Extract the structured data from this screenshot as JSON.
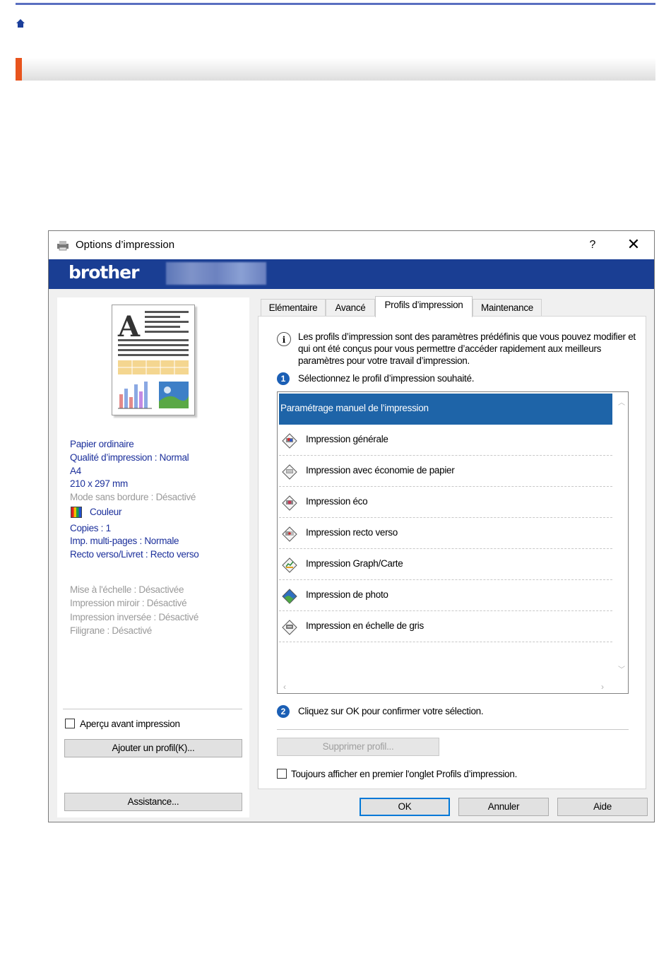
{
  "page": {
    "accent_color": "#e8541d",
    "line_color": "#5a6fc0"
  },
  "dialog": {
    "title": "Options d’impression",
    "help_label": "?",
    "close_label": "✕",
    "brand": "brother",
    "brand_color": "#1a3e93"
  },
  "summary": {
    "paper_type": "Papier ordinaire",
    "quality": "Qualité d’impression : Normal",
    "paper_size": "A4",
    "paper_dims": "210 x 297 mm",
    "borderless": "Mode sans bordure : Désactivé",
    "color_mode": "Couleur",
    "copies": "Copies : 1",
    "multipage": "Imp. multi-pages : Normale",
    "duplex": "Recto verso/Livret : Recto verso",
    "scaling": "Mise à l'échelle : Désactivée",
    "mirror": "Impression miroir : Désactivé",
    "reverse": "Impression inversée : Désactivé",
    "watermark": "Filigrane : Désactivé"
  },
  "left": {
    "preview_checkbox": "Aperçu avant impression",
    "add_profile": "Ajouter un profil(K)...",
    "assistance": "Assistance..."
  },
  "tabs": [
    {
      "label": "Elémentaire"
    },
    {
      "label": "Avancé"
    },
    {
      "label": "Profils d’impression"
    },
    {
      "label": "Maintenance"
    }
  ],
  "profiles": {
    "description": "Les profils d’impression sont des paramètres prédéfinis que vous pouvez modifier et qui ont été conçus pour vous permettre d’accéder rapidement aux meilleurs paramètres pour votre travail d’impression.",
    "step1_number": "1",
    "step1": "Sélectionnez le profil d’impression souhaité.",
    "items": [
      {
        "label": "Paramétrage manuel de l’impression",
        "icon": "none"
      },
      {
        "label": "Impression générale",
        "icon": "general-print-icon"
      },
      {
        "label": "Impression avec économie de papier",
        "icon": "paper-saving-icon"
      },
      {
        "label": "Impression éco",
        "icon": "eco-print-icon"
      },
      {
        "label": "Impression recto verso",
        "icon": "duplex-print-icon"
      },
      {
        "label": "Impression Graph/Carte",
        "icon": "graph-card-icon"
      },
      {
        "label": "Impression de photo",
        "icon": "photo-print-icon"
      },
      {
        "label": "Impression en échelle de gris",
        "icon": "grayscale-print-icon"
      }
    ],
    "selected_index": 0,
    "step2_number": "2",
    "step2": "Cliquez sur OK pour confirmer votre sélection.",
    "delete_button": "Supprimer profil...",
    "always_show": "Toujours afficher en premier l'onglet Profils d’impression."
  },
  "footer": {
    "ok": "OK",
    "cancel": "Annuler",
    "help": "Aide"
  }
}
